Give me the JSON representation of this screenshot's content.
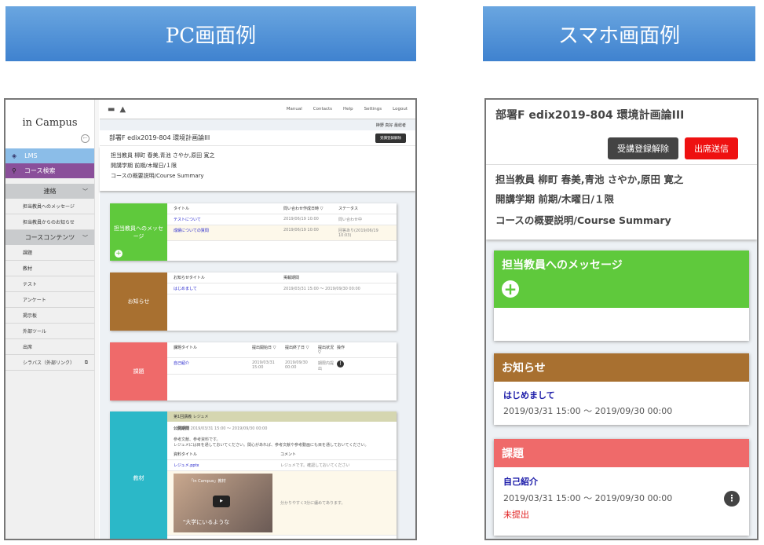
{
  "banners": {
    "pc": "PC画面例",
    "sp": "スマホ画面例"
  },
  "pc": {
    "logo": "in Campus",
    "nav": [
      {
        "label": "LMS",
        "icon": "graduation-cap-icon",
        "color": "#8bbde8"
      },
      {
        "label": "コース検索",
        "icon": "search-icon",
        "color": "#8a4f9a"
      }
    ],
    "sections": [
      {
        "title": "連絡",
        "items": [
          "担当教員へのメッセージ",
          "担当教員からのお知らせ"
        ]
      },
      {
        "title": "コースコンテンツ",
        "items": [
          "課題",
          "教材",
          "テスト",
          "アンケート",
          "掲示板",
          "外部ツール",
          "出席",
          "シラバス（外部リンク）"
        ]
      }
    ],
    "toplinks": [
      "Manual",
      "Contacts",
      "Help",
      "Settings",
      "Logout"
    ],
    "user": "榊野 真好 最総者",
    "course_title": "部署F edix2019-804 環境計画論III",
    "unenroll": "受講登録解除",
    "teachers": "担当教員 柳町 春美,青池 さやか,原田 寛之",
    "term": "開講学期 前期/木曜日/１限",
    "summary": "コースの概要説明/Course Summary",
    "message": {
      "label": "担当教員へのメッセージ",
      "headers": [
        "タイトル",
        "問い合わせ作成日時 ▽",
        "ステータス"
      ],
      "rows": [
        [
          "テストについて",
          "2019/06/19 10:00",
          "問い合わせ中"
        ],
        [
          "成績についての質問",
          "2019/06/19 10:00",
          "回答あり(2019/06/19 10:03)"
        ]
      ]
    },
    "notice": {
      "label": "お知らせ",
      "headers": [
        "お知らせタイトル",
        "掲載期間"
      ],
      "rows": [
        [
          "はじめまして",
          "2019/03/31 15:00 〜 2019/09/30 00:00"
        ]
      ]
    },
    "assign": {
      "label": "課題",
      "headers": [
        "課題タイトル",
        "提出開始日 ▽",
        "提出終了日 ▽",
        "提出状況 ▽",
        "操作"
      ],
      "rows": [
        [
          "自己紹介",
          "2019/03/31 15:00",
          "2019/09/30 00:00",
          "期限内提出"
        ]
      ]
    },
    "material": {
      "label": "教材",
      "section": "第1回講義 レジュメ",
      "period_label": "公開期間",
      "period": "2019/03/31 15:00 〜 2019/09/30 00:00",
      "desc1": "参考文献、参考資料です。",
      "desc2": "レジュメには目を通しておいてください。関心があれば、参考文献や参考動画にも目を通しておいてください。",
      "headers": [
        "資料タイトル",
        "コメント"
      ],
      "file": "レジュメ.pptx",
      "file_comment": "レジュメです。確認しておいてください",
      "video_title": "「in Campus」教材",
      "video_caption": "\"大学にいるような",
      "video_comment": "分かりやすく3分に纏めてあります。"
    }
  },
  "sp": {
    "course_title": "部署F edix2019-804 環境計画論III",
    "unenroll": "受講登録解除",
    "attend": "出席送信",
    "teachers": "担当教員 柳町 春美,青池 さやか,原田 寛之",
    "term": "開講学期 前期/木曜日/１限",
    "summary": "コースの概要説明/Course Summary",
    "message": "担当教員へのメッセージ",
    "notice": "お知らせ",
    "notice_title": "はじめまして",
    "notice_period": "2019/03/31 15:00 〜 2019/09/30 00:00",
    "assign": "課題",
    "assign_title": "自己紹介",
    "assign_period": "2019/03/31 15:00 〜 2019/09/30 00:00",
    "assign_status": "未提出"
  }
}
